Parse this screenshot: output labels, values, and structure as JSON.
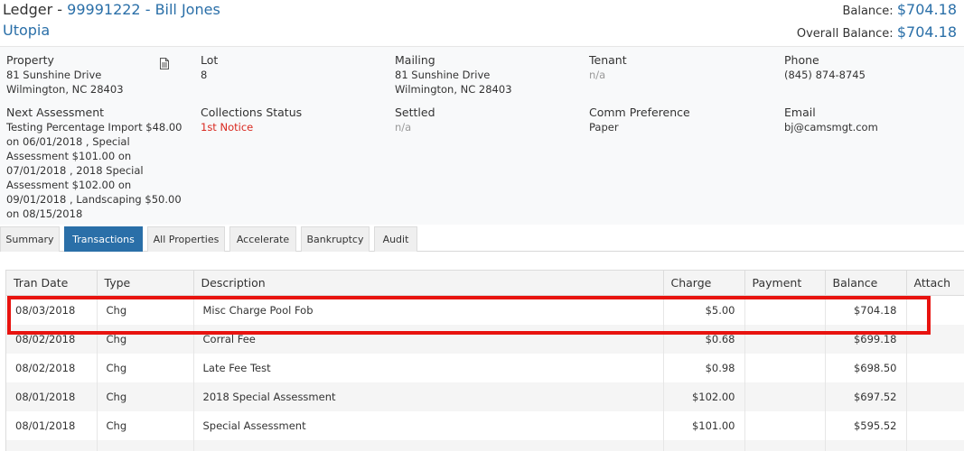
{
  "header": {
    "ledger_label": "Ledger",
    "separator": " - ",
    "account_number": "99991222",
    "owner_name": "Bill Jones",
    "community": "Utopia",
    "balance_label": "Balance:",
    "balance_value": "$704.18",
    "overall_balance_label": "Overall Balance:",
    "overall_balance_value": "$704.18"
  },
  "info": {
    "property": {
      "label": "Property",
      "value": "81 Sunshine Drive\nWilmington, NC 28403"
    },
    "lot": {
      "label": "Lot",
      "value": "8"
    },
    "mailing": {
      "label": "Mailing",
      "value": "81 Sunshine Drive\nWilmington, NC 28403"
    },
    "tenant": {
      "label": "Tenant",
      "value": "n/a"
    },
    "phone": {
      "label": "Phone",
      "value": "(845) 874-8745"
    },
    "next_assessment": {
      "label": "Next Assessment",
      "value": "Testing Percentage Import $48.00\non 06/01/2018 , Special\nAssessment $101.00 on\n07/01/2018 , 2018 Special\nAssessment $102.00 on\n09/01/2018 , Landscaping $50.00\non 08/15/2018"
    },
    "collections_status": {
      "label": "Collections Status",
      "value": "1st Notice"
    },
    "settled": {
      "label": "Settled",
      "value": "n/a"
    },
    "comm_preference": {
      "label": "Comm Preference",
      "value": "Paper"
    },
    "email": {
      "label": "Email",
      "value": "bj@camsmgt.com"
    }
  },
  "icons": {
    "property_doc": "document-icon"
  },
  "tabs": [
    {
      "label": "Summary",
      "active": false
    },
    {
      "label": "Transactions",
      "active": true
    },
    {
      "label": "All Properties",
      "active": false
    },
    {
      "label": "Accelerate",
      "active": false
    },
    {
      "label": "Bankruptcy",
      "active": false
    },
    {
      "label": "Audit",
      "active": false
    }
  ],
  "table": {
    "columns": [
      "Tran Date",
      "Type",
      "Description",
      "Charge",
      "Payment",
      "Balance",
      "Attach"
    ],
    "rows": [
      {
        "date": "08/03/2018",
        "type": "Chg",
        "description": "Misc Charge Pool Fob",
        "charge": "$5.00",
        "payment": "",
        "balance": "$704.18",
        "attach": ""
      },
      {
        "date": "08/02/2018",
        "type": "Chg",
        "description": "Corral Fee",
        "charge": "$0.68",
        "payment": "",
        "balance": "$699.18",
        "attach": ""
      },
      {
        "date": "08/02/2018",
        "type": "Chg",
        "description": "Late Fee Test",
        "charge": "$0.98",
        "payment": "",
        "balance": "$698.50",
        "attach": ""
      },
      {
        "date": "08/01/2018",
        "type": "Chg",
        "description": "2018 Special Assessment",
        "charge": "$102.00",
        "payment": "",
        "balance": "$697.52",
        "attach": ""
      },
      {
        "date": "08/01/2018",
        "type": "Chg",
        "description": "Special Assessment",
        "charge": "$101.00",
        "payment": "",
        "balance": "$595.52",
        "attach": ""
      },
      {
        "date": "",
        "type": "",
        "description": "",
        "charge": "",
        "payment": "",
        "balance": "",
        "attach": ""
      }
    ]
  },
  "colors": {
    "accent": "#2a6fa8",
    "collections_status": "#d9281f",
    "highlight_box": "#e8130f"
  }
}
